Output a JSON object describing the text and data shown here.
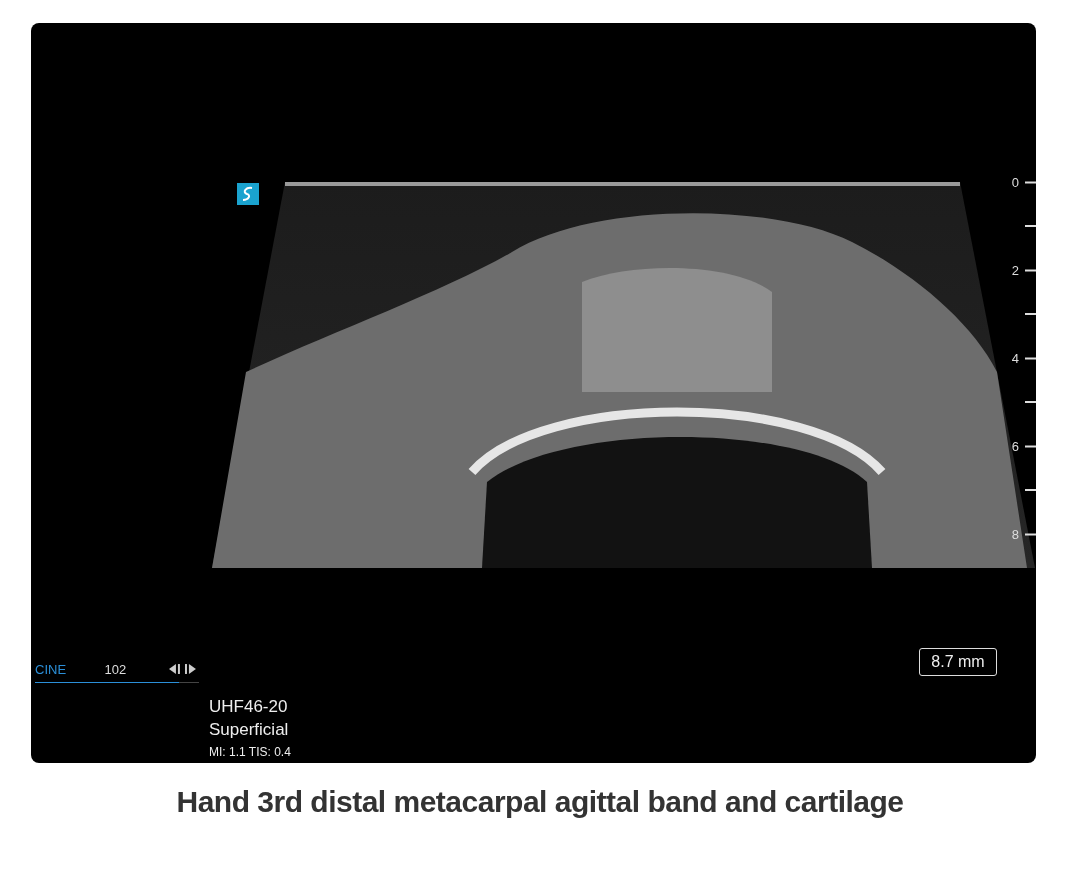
{
  "screen": {
    "depth_scale": [
      "0",
      "2",
      "4",
      "6",
      "8"
    ],
    "cine": {
      "label": "CINE",
      "frame": "102",
      "level": 0.88
    },
    "probe": {
      "model": "UHF46-20",
      "preset": "Superficial",
      "indices": "MI: 1.1  TIS: 0.4"
    },
    "measurement": "8.7 mm"
  },
  "caption": "Hand 3rd distal metacarpal agittal band and cartilage"
}
